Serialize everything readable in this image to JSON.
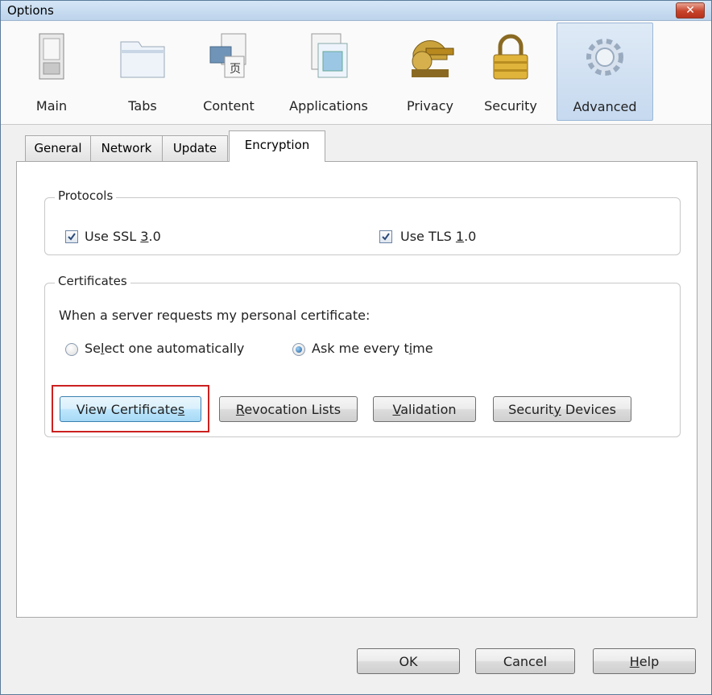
{
  "window": {
    "title": "Options",
    "close_glyph": "✕"
  },
  "toolbar": {
    "panes": [
      {
        "label": "Main",
        "icon": "switch-icon"
      },
      {
        "label": "Tabs",
        "icon": "tabs-icon"
      },
      {
        "label": "Content",
        "icon": "content-icon"
      },
      {
        "label": "Applications",
        "icon": "applications-icon"
      },
      {
        "label": "Privacy",
        "icon": "privacy-icon"
      },
      {
        "label": "Security",
        "icon": "lock-icon"
      },
      {
        "label": "Advanced",
        "icon": "gear-icon"
      }
    ],
    "selected": "Advanced"
  },
  "tabs": [
    {
      "label": "General"
    },
    {
      "label": "Network"
    },
    {
      "label": "Update"
    },
    {
      "label": "Encryption"
    }
  ],
  "active_tab": "Encryption",
  "protocols": {
    "legend": "Protocols",
    "ssl": {
      "label_pre": "Use SSL ",
      "label_key": "3",
      "label_post": ".0",
      "checked": true
    },
    "tls": {
      "label_pre": "Use TLS ",
      "label_key": "1",
      "label_post": ".0",
      "checked": true
    }
  },
  "certificates": {
    "legend": "Certificates",
    "prompt": "When a server requests my personal certificate:",
    "auto": {
      "pre": "Se",
      "key": "l",
      "post": "ect one automatically",
      "selected": false
    },
    "ask": {
      "pre": "Ask me every t",
      "key": "i",
      "post": "me",
      "selected": true
    },
    "buttons": {
      "view": {
        "pre": "View Certificate",
        "key": "s",
        "post": ""
      },
      "revocation": {
        "pre": "",
        "key": "R",
        "post": "evocation Lists"
      },
      "validation": {
        "pre": "",
        "key": "V",
        "post": "alidation"
      },
      "devices": {
        "pre": "Securit",
        "key": "y",
        "post": " Devices"
      }
    }
  },
  "footer": {
    "ok": "OK",
    "cancel": "Cancel",
    "help": {
      "key": "H",
      "post": "elp"
    }
  },
  "colors": {
    "highlight": "#cc2020",
    "title_bar": "#bcd3ea",
    "selected_pane": "#c6d9ef"
  }
}
